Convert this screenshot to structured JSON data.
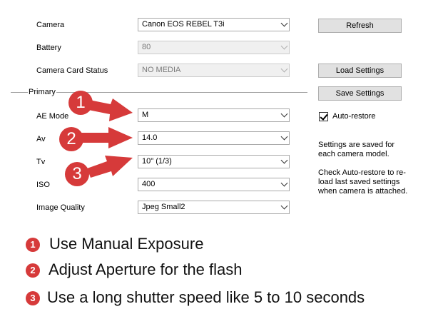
{
  "form": {
    "camera": {
      "label": "Camera",
      "value": "Canon EOS REBEL T3i"
    },
    "battery": {
      "label": "Battery",
      "value": "80"
    },
    "card_status": {
      "label": "Camera Card Status",
      "value": "NO MEDIA"
    },
    "group_label": "Primary",
    "ae_mode": {
      "label": "AE Mode",
      "value": "M"
    },
    "av": {
      "label": "Av",
      "value": "14.0"
    },
    "tv": {
      "label": "Tv",
      "value": "10\" (1/3)"
    },
    "iso": {
      "label": "ISO",
      "value": "400"
    },
    "image_quality": {
      "label": "Image Quality",
      "value": "Jpeg Small2"
    }
  },
  "buttons": {
    "refresh": "Refresh",
    "load": "Load Settings",
    "save": "Save Settings"
  },
  "auto_restore": {
    "label": "Auto-restore",
    "checked": true
  },
  "notes": {
    "saved": "Settings are saved for each camera model.",
    "check": "Check Auto-restore to re-load last saved settings when camera is attached."
  },
  "callouts": {
    "numbers": [
      "1",
      "2",
      "3"
    ],
    "color": "#d63a3a"
  },
  "legend": [
    {
      "num": "1",
      "text": "Use Manual Exposure"
    },
    {
      "num": "2",
      "text": "Adjust Aperture for the flash"
    },
    {
      "num": "3",
      "text": "Use a long shutter speed like 5 to 10 seconds"
    }
  ]
}
